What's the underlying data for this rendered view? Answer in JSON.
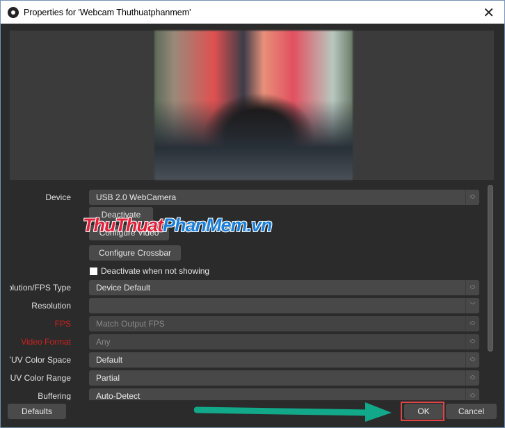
{
  "window": {
    "title": "Properties for 'Webcam Thuthuatphanmem'",
    "close": "✕"
  },
  "device": {
    "label": "Device",
    "value": "USB 2.0 WebCamera"
  },
  "buttons": {
    "deactivate": "Deactivate",
    "configure_video": "Configure Video",
    "configure_crossbar": "Configure Crossbar"
  },
  "deactivate_when_not_showing": {
    "label": "Deactivate when not showing",
    "checked": false
  },
  "fields": [
    {
      "label": "Resolution/FPS Type",
      "value": "Device Default"
    },
    {
      "label": "Resolution",
      "value": ""
    },
    {
      "label": "FPS",
      "value": "Match Output FPS"
    },
    {
      "label": "Video Format",
      "value": "Any"
    },
    {
      "label": "YUV Color Space",
      "value": "Default"
    },
    {
      "label": "YUV Color Range",
      "value": "Partial"
    },
    {
      "label": "Buffering",
      "value": "Auto-Detect"
    }
  ],
  "footer": {
    "defaults": "Defaults",
    "ok": "OK",
    "cancel": "Cancel"
  },
  "watermark": {
    "part1": "ThuThuat",
    "part2": "PhanMem.vn"
  },
  "colors": {
    "highlight": "#e04545",
    "arrow": "#12a88a",
    "error_label": "#d02020"
  }
}
